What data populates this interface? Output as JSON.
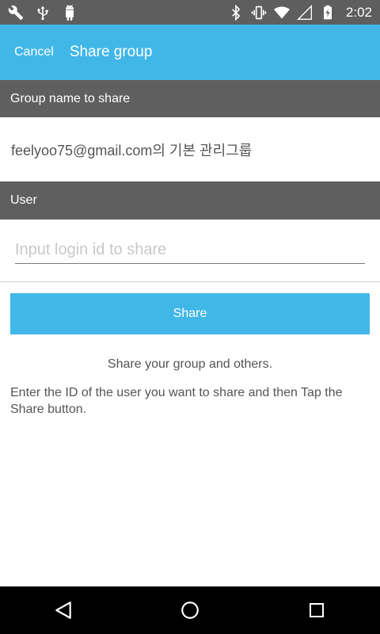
{
  "status_bar": {
    "time": "2:02",
    "left_icons": [
      "wrench-icon",
      "usb-icon",
      "android-icon"
    ],
    "right_icons": [
      "bluetooth-icon",
      "vibrate-icon",
      "wifi-icon",
      "signal-icon",
      "battery-charging-icon"
    ]
  },
  "app_bar": {
    "cancel_label": "Cancel",
    "title": "Share group",
    "color": "#41b7e8"
  },
  "group_section": {
    "header": "Group name to share",
    "group_name": "feelyoo75@gmail.com의 기본 관리그룹"
  },
  "user_section": {
    "header": "User",
    "input_placeholder": "Input login id to share",
    "input_value": ""
  },
  "share_button": {
    "label": "Share"
  },
  "info": {
    "description": "Share your group and others.",
    "instruction": "Enter the ID of the user you want to share and then Tap the Share button."
  },
  "nav_bar": {
    "buttons": [
      "back-icon",
      "home-icon",
      "recents-icon"
    ]
  }
}
